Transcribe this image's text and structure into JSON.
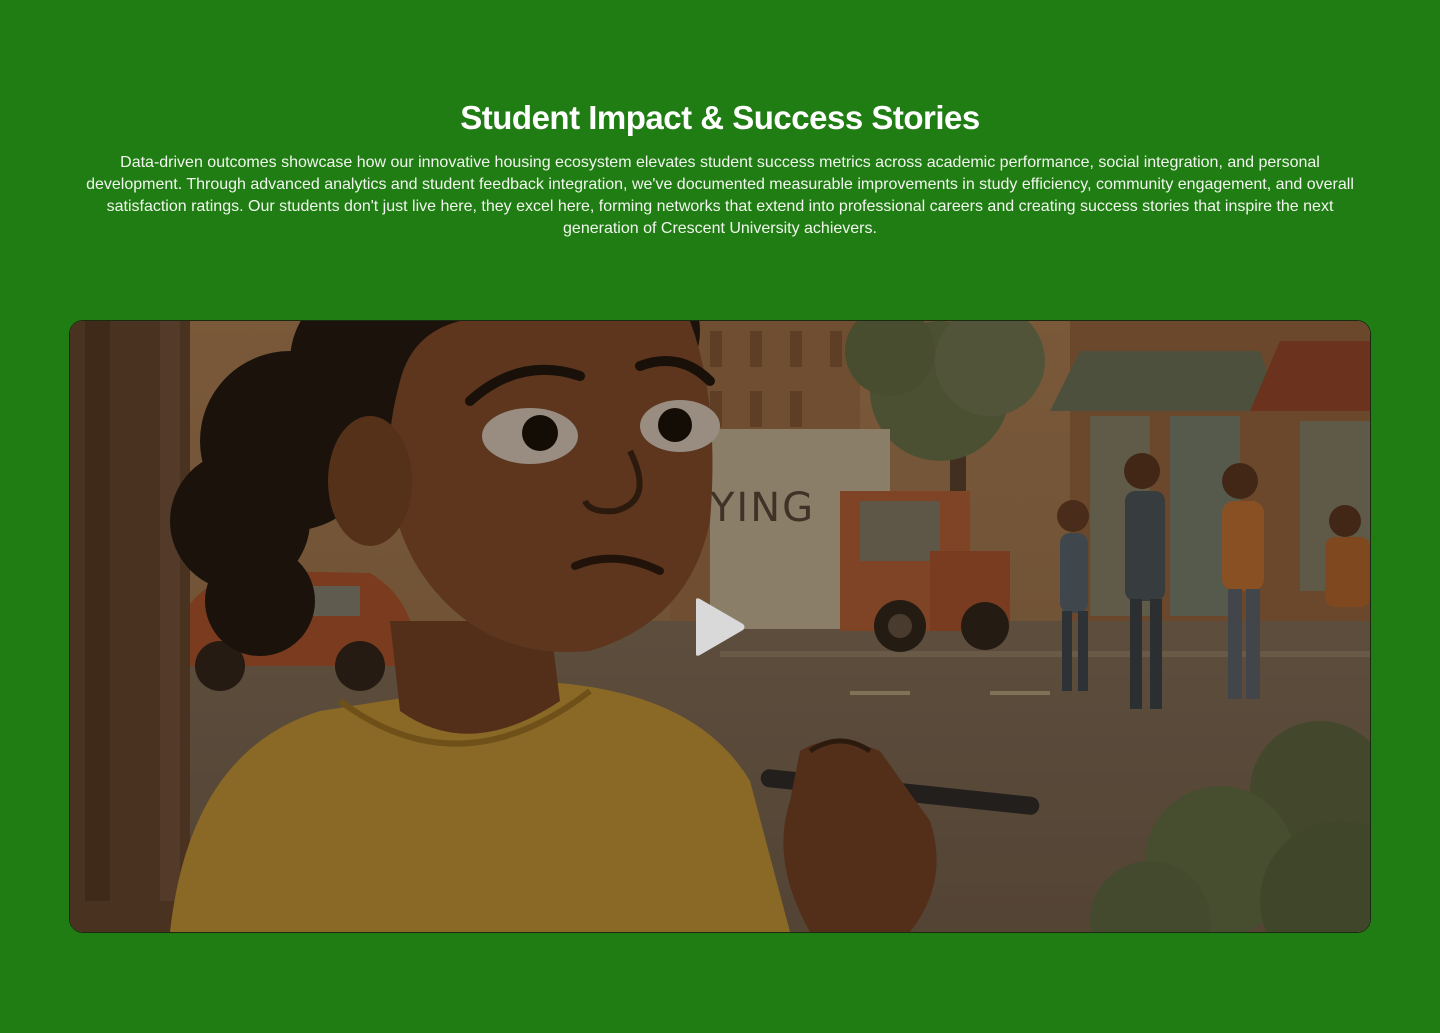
{
  "section": {
    "title": "Student Impact & Success Stories",
    "description": "Data-driven outcomes showcase how our innovative housing ecosystem elevates student success metrics across academic performance, social integration, and personal development. Through advanced analytics and student feedback integration, we've documented measurable improvements in study efficiency, community engagement, and overall satisfaction ratings. Our students don't just live here, they excel here, forming networks that extend into professional careers and creating success stories that inspire the next generation of Crescent University achievers."
  },
  "video": {
    "truck_sign": "YING",
    "play_icon": "play-icon"
  },
  "colors": {
    "background": "#207d13",
    "heading": "#ffffff",
    "play_icon": "#d9d9d9"
  }
}
